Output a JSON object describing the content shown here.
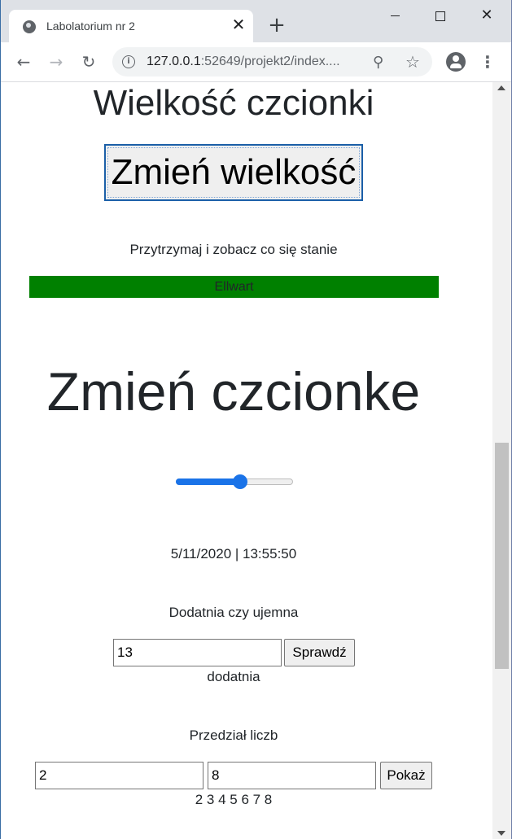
{
  "browser": {
    "tab_title": "Labolatorium nr 2",
    "close_tab_symbol": "✕",
    "new_tab_symbol": "+",
    "url_host": "127.0.0.1",
    "url_rest": ":52649/projekt2/index....",
    "icons": [
      "globe-icon",
      "close-icon",
      "plus-icon",
      "back-arrow-icon",
      "forward-arrow-icon",
      "reload-icon",
      "info-icon",
      "zoom-icon",
      "star-icon",
      "profile-icon",
      "menu-icon"
    ]
  },
  "page": {
    "font_size_heading": "Wielkość czcionki",
    "font_size_button": "Zmień wielkość",
    "hold_text": "Przytrzymaj i zobacz co się stanie",
    "green_bar_text": "Ellwart",
    "green_bar_color": "#008000",
    "change_font_heading": "Zmień czcionke",
    "slider_value_fraction": 0.55,
    "slider_accent_color": "#1a73e8",
    "datetime": "5/11/2020 | 13:55:50",
    "sign_title": "Dodatnia czy ujemna",
    "sign_input_value": "13",
    "sign_button": "Sprawdź",
    "sign_result": "dodatnia",
    "range_title": "Przedział liczb",
    "range_from_value": "2",
    "range_to_value": "8",
    "range_button": "Pokaż",
    "range_result": "2 3 4 5 6 7 8"
  }
}
